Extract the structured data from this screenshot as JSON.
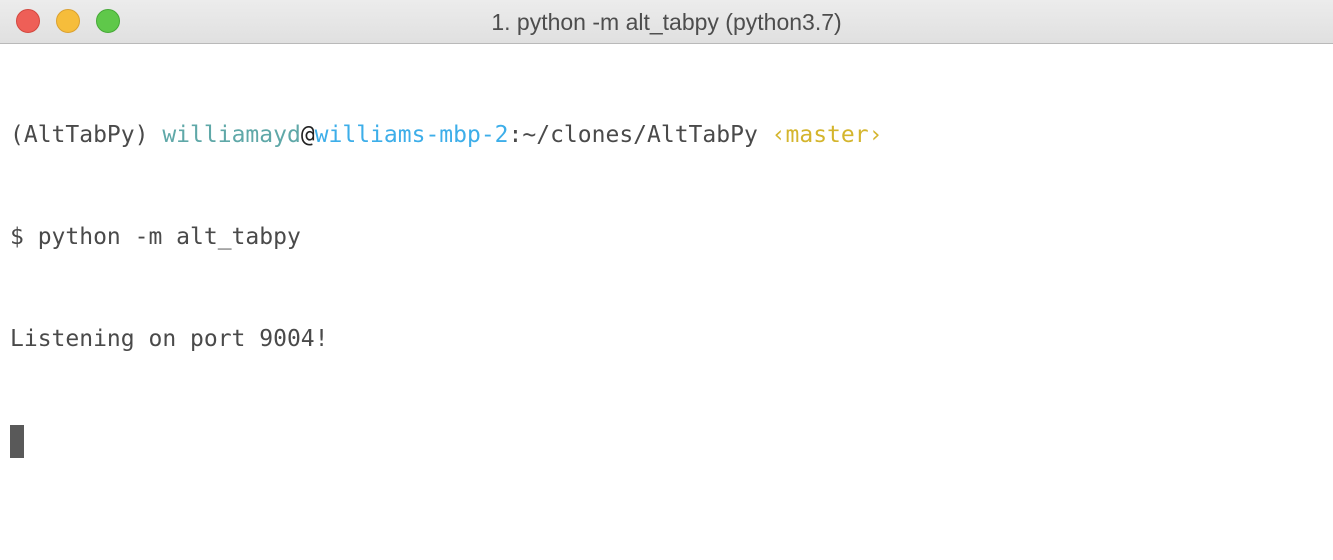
{
  "window": {
    "title": "1. python -m alt_tabpy (python3.7)"
  },
  "colors": {
    "user": "#5fa8a8",
    "at": "#222222",
    "host": "#3daee9",
    "path": "#4a4a4a",
    "branch": "#d4b52d",
    "text": "#4a4a4a"
  },
  "terminal": {
    "prompt": {
      "env": "(AltTabPy) ",
      "user": "williamayd",
      "at": "@",
      "host": "williams-mbp-2",
      "sep_path": ":~/clones/AltTabPy ",
      "branch": "‹master›"
    },
    "command": "$ python -m alt_tabpy",
    "output": "Listening on port 9004!"
  }
}
